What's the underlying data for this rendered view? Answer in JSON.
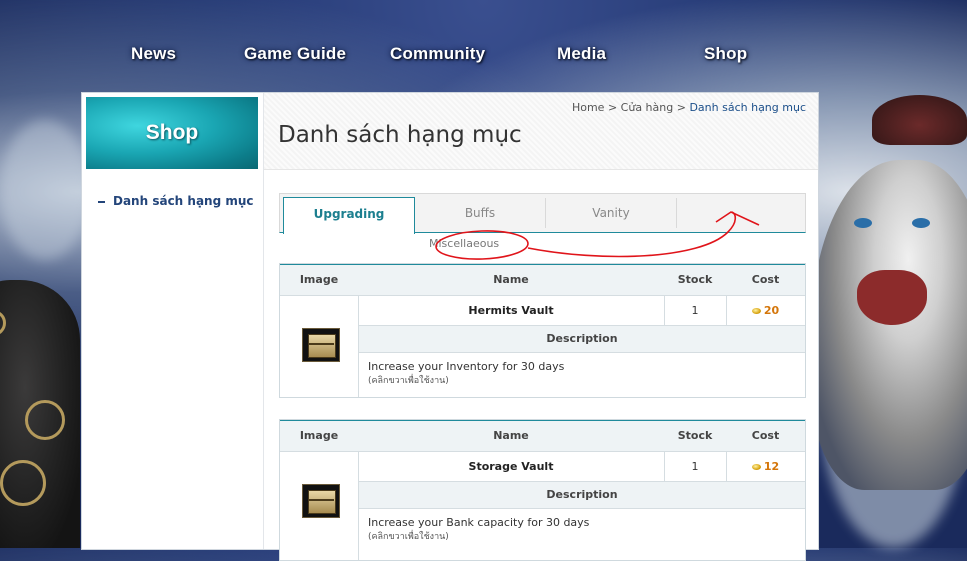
{
  "nav": {
    "items": [
      "News",
      "Game Guide",
      "Community",
      "Media",
      "Shop"
    ]
  },
  "sidebar": {
    "banner_title": "Shop",
    "link": "Danh sách hạng mục"
  },
  "breadcrumb": {
    "home": "Home",
    "sep1": ">",
    "store": "Cửa hàng",
    "sep2": ">",
    "current": "Danh sách hạng mục"
  },
  "page_title": "Danh sách hạng mục",
  "tabs": {
    "items": [
      "Upgrading",
      "Buffs",
      "Vanity"
    ],
    "active": "Upgrading",
    "extra": "Miscellaeous"
  },
  "table_headers": {
    "image": "Image",
    "name": "Name",
    "stock": "Stock",
    "cost": "Cost",
    "description": "Description"
  },
  "items": [
    {
      "name": "Hermits Vault",
      "stock": "1",
      "cost": "20",
      "description": "Increase your Inventory for 30 days",
      "hint": "(คลิกขวาเพื่อใช้งาน)",
      "icon": "chest-icon"
    },
    {
      "name": "Storage Vault",
      "stock": "1",
      "cost": "12",
      "description": "Increase your Bank capacity for 30 days",
      "hint": "(คลิกขวาเพื่อใช้งาน)",
      "icon": "storage-chest-icon"
    }
  ],
  "colors": {
    "accent": "#1f8a9b",
    "link": "#23457a",
    "cost": "#d4760a",
    "annotation": "#e0141a"
  }
}
